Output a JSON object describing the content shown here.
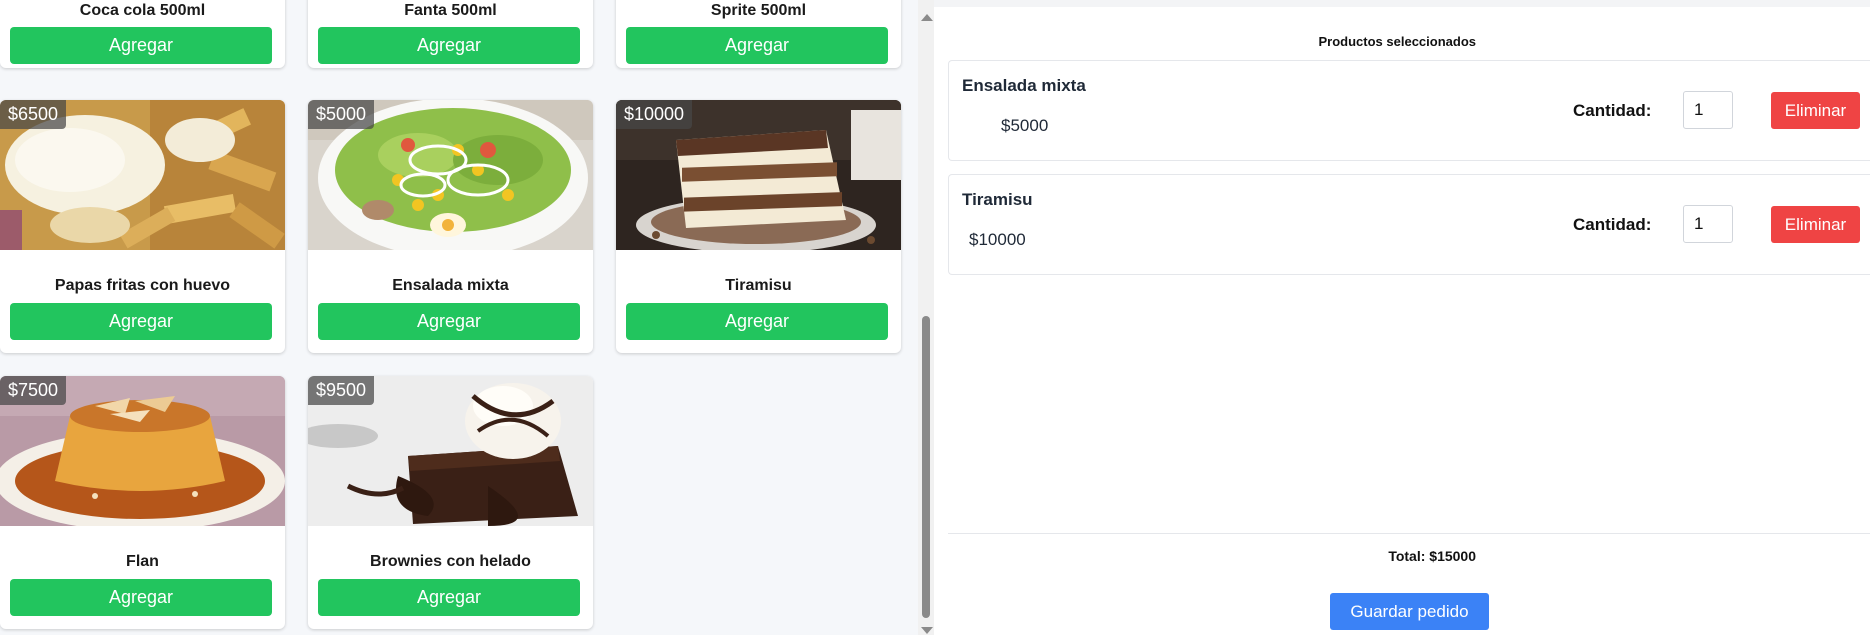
{
  "products": {
    "top_row_names": [
      "Coca cola 500ml",
      "Fanta 500ml",
      "Sprite 500ml"
    ],
    "add_label": "Agregar",
    "items": [
      {
        "name": "Papas fritas con huevo",
        "price": "$6500",
        "image_icon": "fries-egg-image"
      },
      {
        "name": "Ensalada mixta",
        "price": "$5000",
        "image_icon": "salad-image"
      },
      {
        "name": "Tiramisu",
        "price": "$10000",
        "image_icon": "tiramisu-image"
      },
      {
        "name": "Flan",
        "price": "$7500",
        "image_icon": "flan-image"
      },
      {
        "name": "Brownies con helado",
        "price": "$9500",
        "image_icon": "brownie-image"
      }
    ]
  },
  "selected": {
    "title": "Productos seleccionados",
    "qty_label": "Cantidad:",
    "delete_label": "Eliminar",
    "items": [
      {
        "name": "Ensalada mixta",
        "price": "$5000",
        "qty": "1"
      },
      {
        "name": "Tiramisu",
        "price": "$10000",
        "qty": "1"
      }
    ],
    "total": "Total: $15000",
    "save_label": "Guardar pedido"
  },
  "colors": {
    "add_button": "#22c55e",
    "delete_button": "#ef4444",
    "save_button": "#3b82f6"
  }
}
